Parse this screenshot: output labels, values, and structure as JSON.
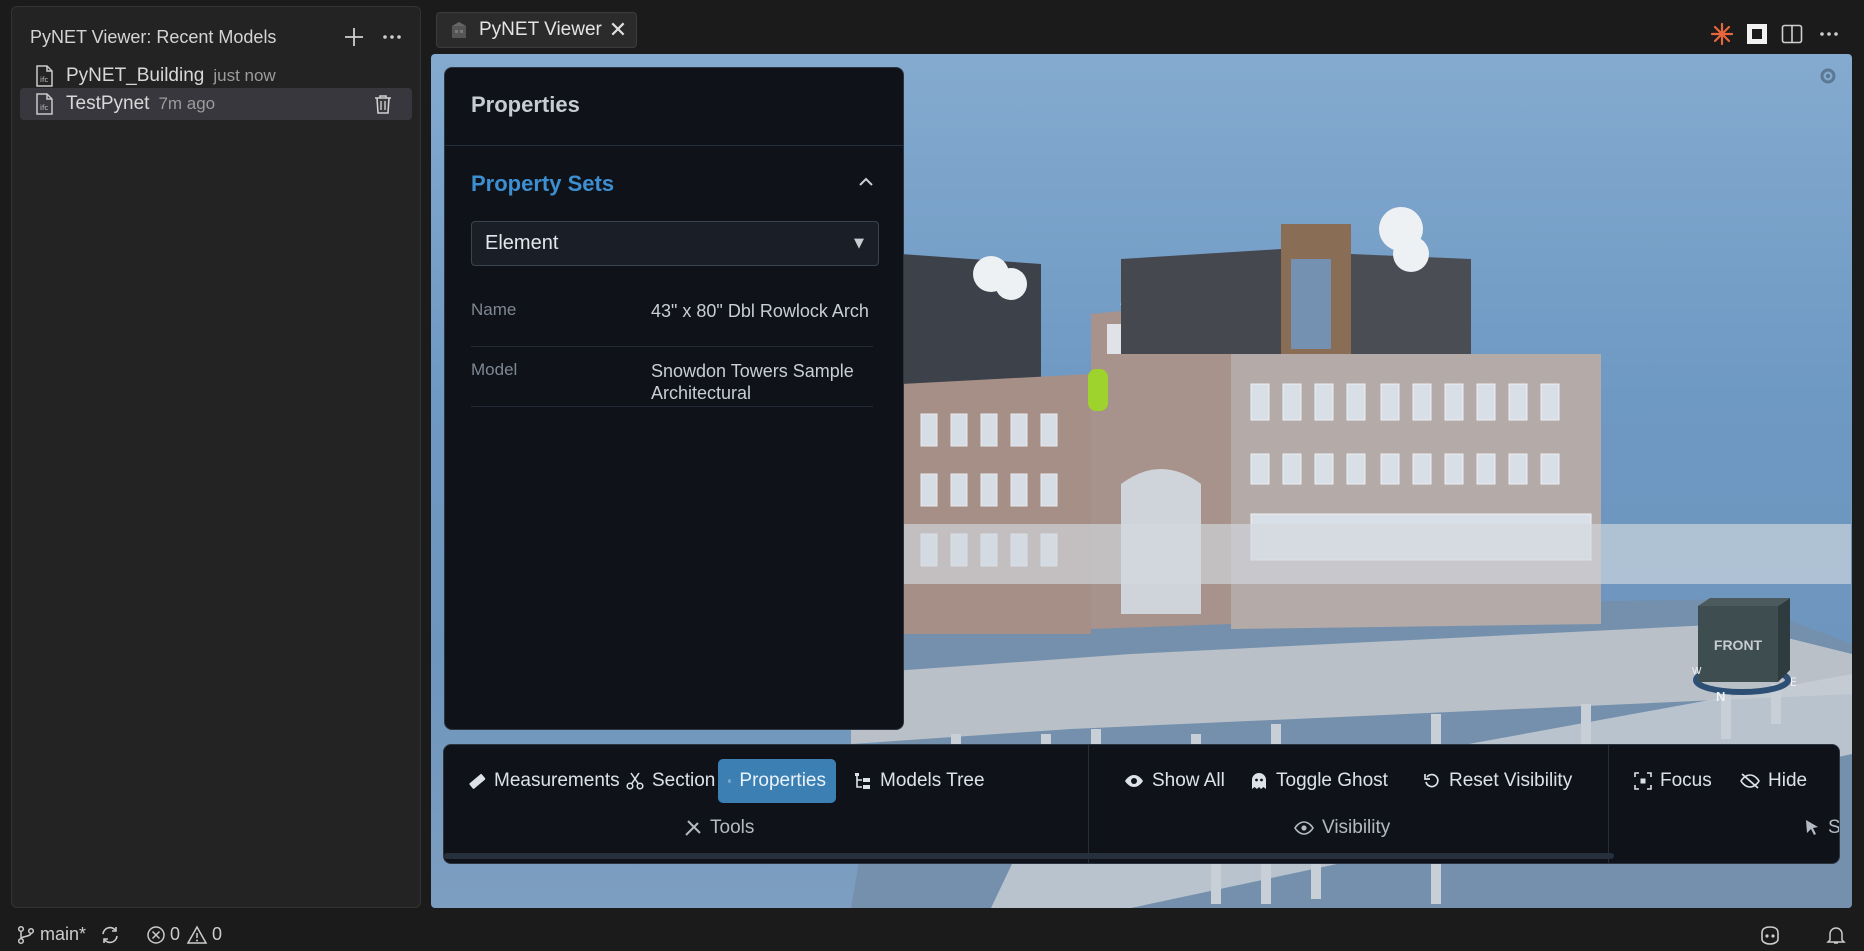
{
  "sidebar": {
    "title": "PyNET Viewer: Recent Models",
    "add_icon": "plus-icon",
    "more_icon": "ellipsis-icon",
    "items": [
      {
        "name": "PyNET_Building",
        "time": "just now",
        "icon": "ifc-file-icon"
      },
      {
        "name": "TestPynet",
        "time": "7m ago",
        "icon": "ifc-file-icon",
        "selected": true
      }
    ]
  },
  "tab": {
    "label": "PyNET Viewer",
    "close_glyph": "✕"
  },
  "editor_actions": [
    "copilot-icon",
    "panel-icon",
    "split-editor-icon",
    "ellipsis-icon"
  ],
  "properties": {
    "title": "Properties",
    "section_title": "Property Sets",
    "select_value": "Element",
    "rows": [
      {
        "key": "Name",
        "value": "43\" x 80\" Dbl Rowlock Arch"
      },
      {
        "key": "Model",
        "value": "Snowdon Towers Sample Architectural"
      }
    ]
  },
  "toolbar": {
    "tools": {
      "measurements": "Measurements",
      "section": "Section",
      "properties": "Properties",
      "models_tree": "Models Tree",
      "group": "Tools"
    },
    "visibility": {
      "show_all": "Show All",
      "toggle_ghost": "Toggle Ghost",
      "reset_visibility": "Reset Visibility",
      "group": "Visibility"
    },
    "selection": {
      "focus": "Focus",
      "hide": "Hide",
      "group_partial": "S"
    }
  },
  "navcube": {
    "face": "FRONT",
    "north": "N",
    "east": "E",
    "west": "W"
  },
  "statusbar": {
    "branch": "main*",
    "errors": "0",
    "warnings": "0"
  },
  "colors": {
    "accent": "#3d8fd1",
    "active_button": "#3b7fb3",
    "panel_bg": "#0f1319",
    "sky": "#7ba3cb"
  }
}
